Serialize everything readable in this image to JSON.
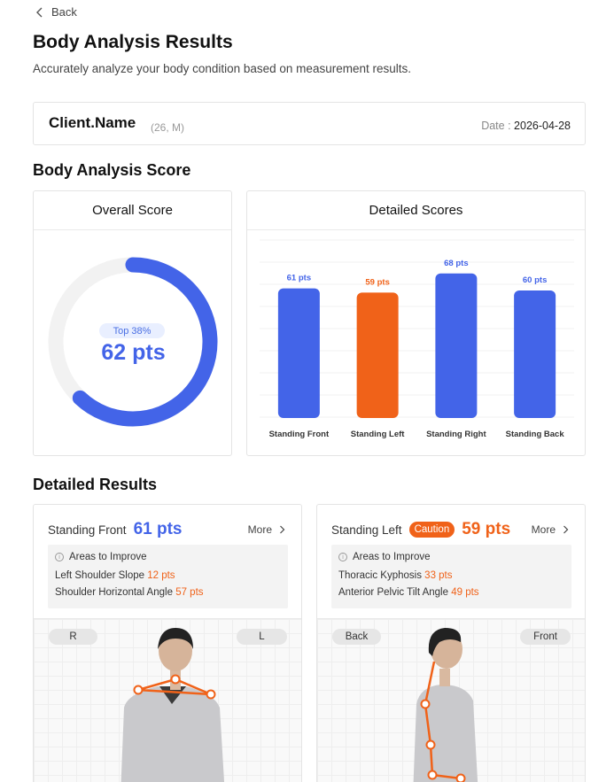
{
  "nav": {
    "back_label": "Back"
  },
  "header": {
    "title": "Body Analysis Results",
    "subtitle": "Accurately analyze your body condition based on measurement results."
  },
  "client": {
    "name": "Client.Name",
    "meta": "(26, M)",
    "date_label": "Date :",
    "date_value": "2026-04-28"
  },
  "score_section": {
    "title": "Body Analysis Score",
    "overall": {
      "title": "Overall Score",
      "rank": "Top 38%",
      "score_text": "62 pts",
      "score_value": 62,
      "max": 100
    },
    "detailed": {
      "title": "Detailed Scores"
    }
  },
  "chart_data": {
    "type": "bar",
    "title": "Detailed Scores",
    "categories": [
      "Standing Front",
      "Standing Left",
      "Standing Right",
      "Standing Back"
    ],
    "values": [
      61,
      59,
      68,
      60
    ],
    "value_labels": [
      "61 pts",
      "59 pts",
      "68 pts",
      "60 pts"
    ],
    "colors": [
      "#4364e8",
      "#f06219",
      "#4364e8",
      "#4364e8"
    ],
    "ylim": [
      0,
      100
    ],
    "grid": true
  },
  "results_section": {
    "title": "Detailed Results",
    "cards": [
      {
        "name": "Standing Front",
        "score": "61 pts",
        "caution": "",
        "more": "More",
        "improve_title": "Areas to Improve",
        "items": [
          {
            "label": "Left Shoulder Slope",
            "pts": "12 pts"
          },
          {
            "label": "Shoulder Horizontal Angle",
            "pts": "57 pts"
          }
        ],
        "side_left": "R",
        "side_right": "L"
      },
      {
        "name": "Standing Left",
        "score": "59 pts",
        "caution": "Caution",
        "more": "More",
        "improve_title": "Areas to Improve",
        "items": [
          {
            "label": "Thoracic Kyphosis",
            "pts": "33 pts"
          },
          {
            "label": "Anterior Pelvic Tilt Angle",
            "pts": "49 pts"
          }
        ],
        "side_left": "Back",
        "side_right": "Front"
      }
    ]
  },
  "colors": {
    "blue": "#4364e8",
    "orange": "#f06219",
    "track": "#f2f2f2"
  }
}
